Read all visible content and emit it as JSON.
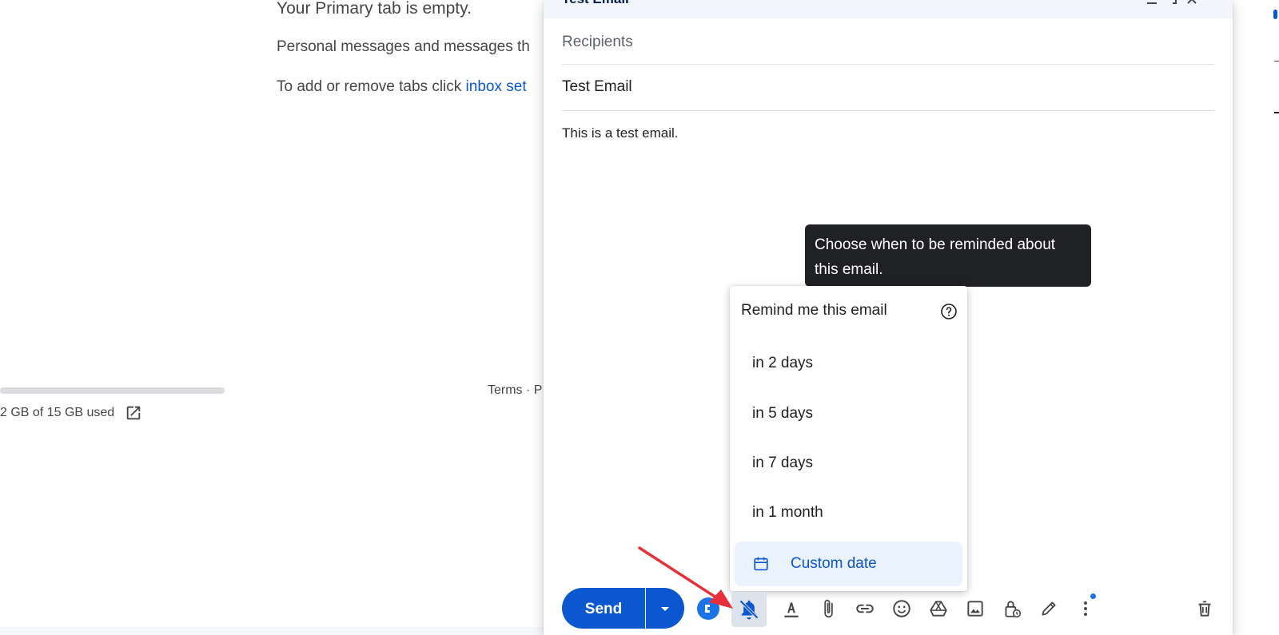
{
  "background": {
    "empty_title": "Your Primary tab is empty.",
    "empty_desc": "Personal messages and messages th",
    "empty_tabs_prefix": "To add or remove tabs click ",
    "empty_tabs_link": "inbox set",
    "storage_text": "2 GB of 15 GB used",
    "footer_terms": "Terms · P"
  },
  "compose": {
    "title": "Test Email",
    "recipients_placeholder": "Recipients",
    "subject": "Test Email",
    "body": "This is a test email."
  },
  "tooltip": {
    "text": "Choose when to be reminded about this email."
  },
  "reminder_menu": {
    "heading": "Remind me this email",
    "items": [
      "in 2 days",
      "in 5 days",
      "in 7 days",
      "in 1 month"
    ],
    "custom_date": "Custom date"
  },
  "toolbar": {
    "send_label": "Send",
    "icons": [
      "formatting-icon",
      "attach-icon",
      "link-icon",
      "emoji-icon",
      "drive-icon",
      "photo-icon",
      "confidential-icon",
      "signature-icon",
      "more-options-icon",
      "delete-icon"
    ]
  },
  "colors": {
    "accent": "#0b57d0",
    "tooltip_bg": "#202124",
    "custom_date_bg": "#eaf2fd",
    "header_bg": "#f2f6fc",
    "annotation_arrow": "#e8303a"
  }
}
